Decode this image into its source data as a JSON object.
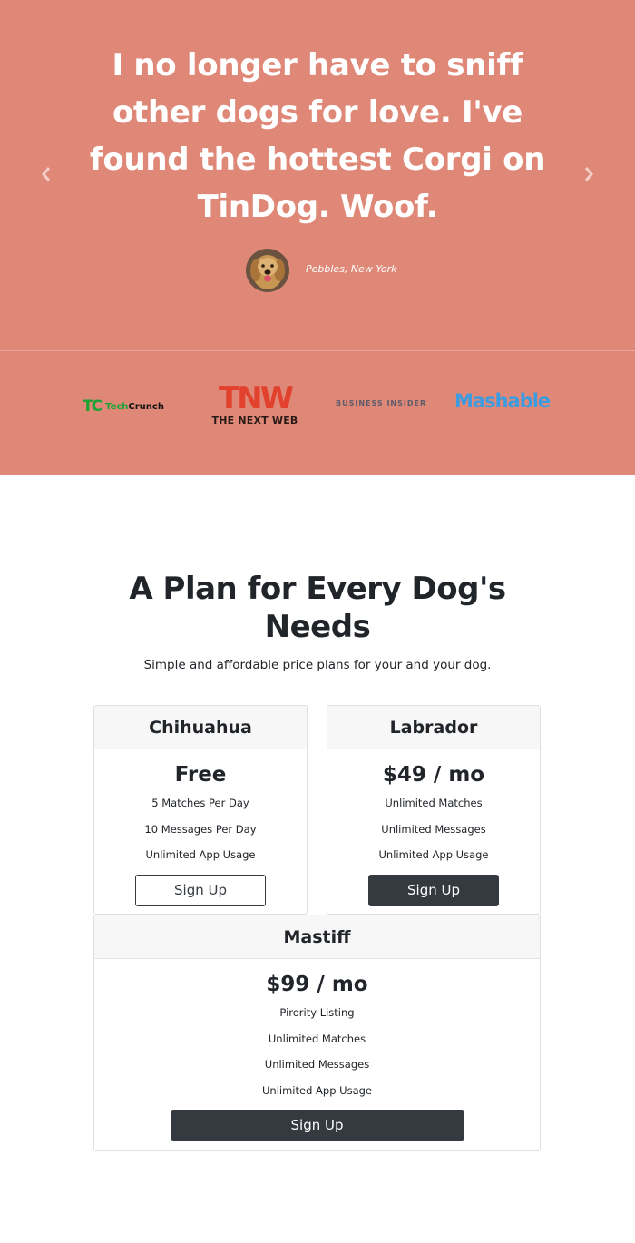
{
  "testimonial": {
    "quote": "I no longer have to sniff other dogs for love. I've found the hottest Corgi on TinDog. Woof.",
    "author": "Pebbles, New York",
    "avatar_icon": "golden-retriever-avatar",
    "prev_icon": "chevron-left-icon",
    "next_icon": "chevron-right-icon",
    "background_color": "#e08877"
  },
  "press": {
    "logos": [
      {
        "name": "TechCrunch",
        "mark": "TC",
        "text_green": "Tech",
        "text_dark": "Crunch"
      },
      {
        "name": "The Next Web",
        "mark": "TNW",
        "sub": "THE NEXT WEB"
      },
      {
        "name": "Business Insider",
        "text": "BUSINESS INSIDER"
      },
      {
        "name": "Mashable",
        "text": "Mashable"
      }
    ]
  },
  "pricing": {
    "title": "A Plan for Every Dog's Needs",
    "subtitle": "Simple and affordable price plans for your and your dog.",
    "plans": [
      {
        "name": "Chihuahua",
        "price": "Free",
        "features": [
          "5 Matches Per Day",
          "10 Messages Per Day",
          "Unlimited App Usage"
        ],
        "button": "Sign Up"
      },
      {
        "name": "Labrador",
        "price": "$49 / mo",
        "features": [
          "Unlimited Matches",
          "Unlimited Messages",
          "Unlimited App Usage"
        ],
        "button": "Sign Up"
      },
      {
        "name": "Mastiff",
        "price": "$99 / mo",
        "features": [
          "Pirority Listing",
          "Unlimited Matches",
          "Unlimited Messages",
          "Unlimited App Usage"
        ],
        "button": "Sign Up"
      }
    ]
  }
}
